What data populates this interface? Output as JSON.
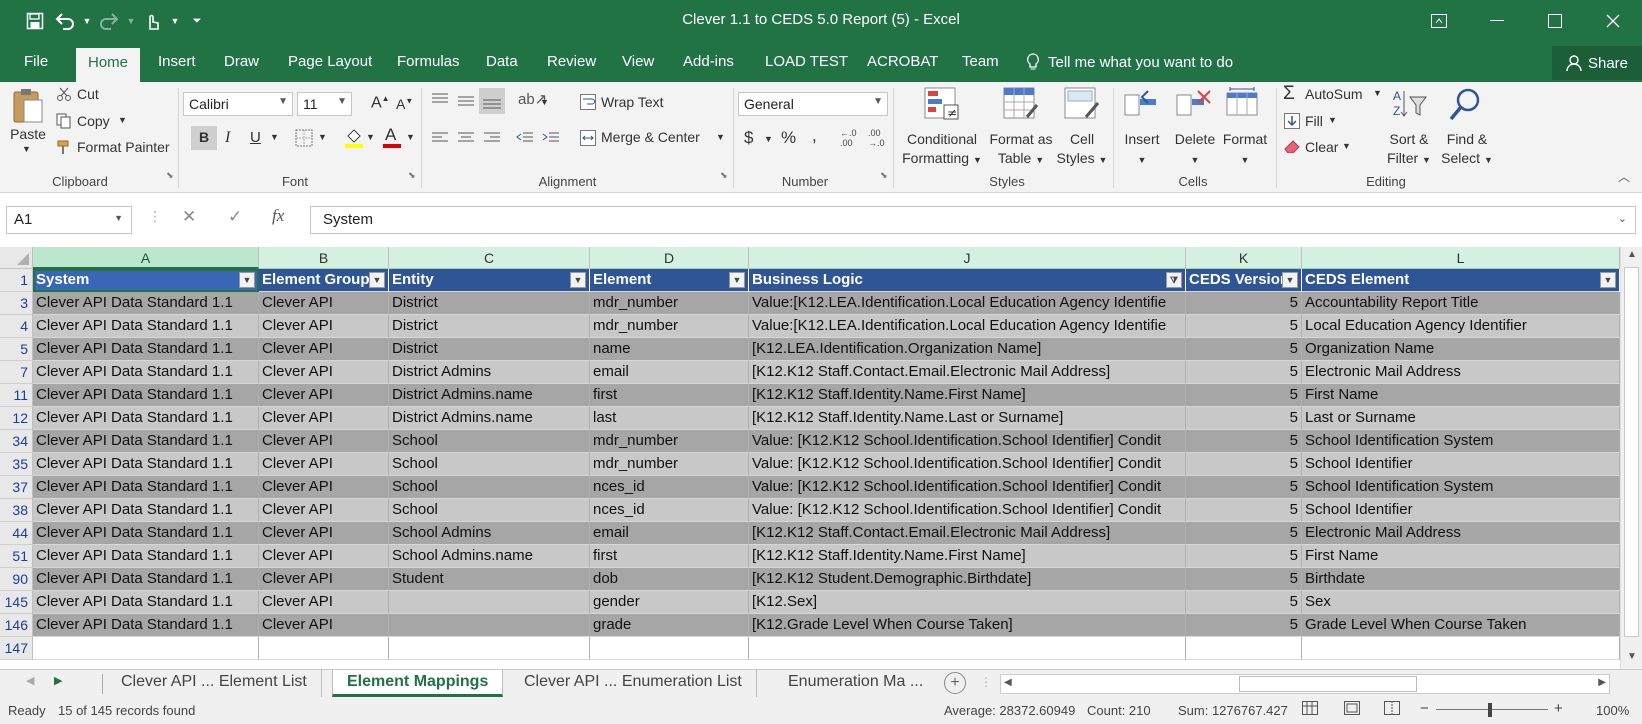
{
  "window": {
    "title": "Clever 1.1 to CEDS 5.0 Report (5) - Excel"
  },
  "ribbon_tabs": [
    "File",
    "Home",
    "Insert",
    "Draw",
    "Page Layout",
    "Formulas",
    "Data",
    "Review",
    "View",
    "Add-ins",
    "LOAD TEST",
    "ACROBAT",
    "Team"
  ],
  "tell_me": "Tell me what you want to do",
  "share_label": "Share",
  "clipboard": {
    "paste": "Paste",
    "cut": "Cut",
    "copy": "Copy",
    "format_painter": "Format Painter",
    "label": "Clipboard"
  },
  "font": {
    "name": "Calibri",
    "size": "11",
    "bold": "B",
    "italic": "I",
    "underline": "U",
    "label": "Font"
  },
  "alignment": {
    "wrap_text": "Wrap Text",
    "merge_center": "Merge & Center",
    "label": "Alignment"
  },
  "number": {
    "format": "General",
    "currency": "$",
    "percent": "%",
    "comma": ",",
    "label": "Number"
  },
  "styles": {
    "conditional": [
      "Conditional",
      "Formatting"
    ],
    "format_table": [
      "Format as",
      "Table"
    ],
    "cell_styles": [
      "Cell",
      "Styles"
    ],
    "label": "Styles"
  },
  "cells": {
    "insert": "Insert",
    "delete": "Delete",
    "format": "Format",
    "label": "Cells"
  },
  "editing": {
    "autosum": "AutoSum",
    "fill": "Fill",
    "clear": "Clear",
    "sort_filter": [
      "Sort &",
      "Filter"
    ],
    "find_select": [
      "Find &",
      "Select"
    ],
    "label": "Editing"
  },
  "formula_bar": {
    "name_box": "A1",
    "fx": "fx",
    "content": "System"
  },
  "columns": [
    {
      "letter": "A"
    },
    {
      "letter": "B"
    },
    {
      "letter": "C"
    },
    {
      "letter": "D"
    },
    {
      "letter": "J"
    },
    {
      "letter": "K"
    },
    {
      "letter": "L"
    }
  ],
  "header_row": {
    "row_number": "1",
    "cells": [
      "System",
      "Element Group",
      "Entity",
      "Element",
      "Business Logic",
      "CEDS Version",
      "CEDS Element"
    ]
  },
  "rows": [
    {
      "n": "3",
      "cells": [
        "Clever API Data Standard 1.1",
        "Clever API",
        "District",
        "mdr_number",
        "Value:[K12.LEA.Identification.Local Education Agency Identifie",
        "5",
        "Accountability Report Title"
      ]
    },
    {
      "n": "4",
      "cells": [
        "Clever API Data Standard 1.1",
        "Clever API",
        "District",
        "mdr_number",
        "Value:[K12.LEA.Identification.Local Education Agency Identifie",
        "5",
        "Local Education Agency Identifier"
      ]
    },
    {
      "n": "5",
      "cells": [
        "Clever API Data Standard 1.1",
        "Clever API",
        "District",
        "name",
        "[K12.LEA.Identification.Organization Name]",
        "5",
        "Organization Name"
      ]
    },
    {
      "n": "7",
      "cells": [
        "Clever API Data Standard 1.1",
        "Clever API",
        "District Admins",
        "email",
        "[K12.K12 Staff.Contact.Email.Electronic Mail Address]",
        "5",
        "Electronic Mail Address"
      ]
    },
    {
      "n": "11",
      "cells": [
        "Clever API Data Standard 1.1",
        "Clever API",
        "District Admins.name",
        "first",
        "[K12.K12 Staff.Identity.Name.First Name]",
        "5",
        "First Name"
      ]
    },
    {
      "n": "12",
      "cells": [
        "Clever API Data Standard 1.1",
        "Clever API",
        "District Admins.name",
        "last",
        "[K12.K12 Staff.Identity.Name.Last or Surname]",
        "5",
        "Last or Surname"
      ]
    },
    {
      "n": "34",
      "cells": [
        "Clever API Data Standard 1.1",
        "Clever API",
        "School",
        "mdr_number",
        "Value: [K12.K12 School.Identification.School Identifier] Condit",
        "5",
        "School Identification System"
      ]
    },
    {
      "n": "35",
      "cells": [
        "Clever API Data Standard 1.1",
        "Clever API",
        "School",
        "mdr_number",
        "Value: [K12.K12 School.Identification.School Identifier] Condit",
        "5",
        "School Identifier"
      ]
    },
    {
      "n": "37",
      "cells": [
        "Clever API Data Standard 1.1",
        "Clever API",
        "School",
        "nces_id",
        "Value: [K12.K12 School.Identification.School Identifier] Condit",
        "5",
        "School Identification System"
      ]
    },
    {
      "n": "38",
      "cells": [
        "Clever API Data Standard 1.1",
        "Clever API",
        "School",
        "nces_id",
        "Value: [K12.K12 School.Identification.School Identifier] Condit",
        "5",
        "School Identifier"
      ]
    },
    {
      "n": "44",
      "cells": [
        "Clever API Data Standard 1.1",
        "Clever API",
        "School Admins",
        "email",
        " [K12.K12 Staff.Contact.Email.Electronic Mail Address]",
        "5",
        "Electronic Mail Address"
      ]
    },
    {
      "n": "51",
      "cells": [
        "Clever API Data Standard 1.1",
        "Clever API",
        "School Admins.name",
        "first",
        " [K12.K12 Staff.Identity.Name.First Name]",
        "5",
        "First Name"
      ]
    },
    {
      "n": "90",
      "cells": [
        "Clever API Data Standard 1.1",
        "Clever API",
        "Student",
        "dob",
        " [K12.K12 Student.Demographic.Birthdate]",
        "5",
        "Birthdate"
      ]
    },
    {
      "n": "145",
      "cells": [
        "Clever API Data Standard 1.1",
        "Clever API",
        "",
        "gender",
        "[K12.Sex]",
        "5",
        "Sex"
      ]
    },
    {
      "n": "146",
      "cells": [
        "Clever API Data Standard 1.1",
        "Clever API",
        "",
        "grade",
        "[K12.Grade Level When Course Taken]",
        "5",
        "Grade Level When Course Taken"
      ]
    },
    {
      "n": "147",
      "cells": [
        "",
        "",
        "",
        "",
        "",
        "",
        ""
      ]
    }
  ],
  "sheets": [
    {
      "name": "Clever API ... Element List",
      "active": false
    },
    {
      "name": "Element Mappings",
      "active": true
    },
    {
      "name": "Clever API ... Enumeration List",
      "active": false
    },
    {
      "name": "Enumeration Ma ...",
      "active": false
    }
  ],
  "status": {
    "ready": "Ready",
    "records": "15 of 145 records found",
    "average": "Average: 28372.60949",
    "count": "Count: 210",
    "sum": "Sum: 1276767.427",
    "zoom": "100%"
  },
  "colors": {
    "accent": "#217346",
    "header_fill": "#2f5597",
    "row_dark": "#a6a6a6",
    "row_light": "#c8c8c8"
  }
}
